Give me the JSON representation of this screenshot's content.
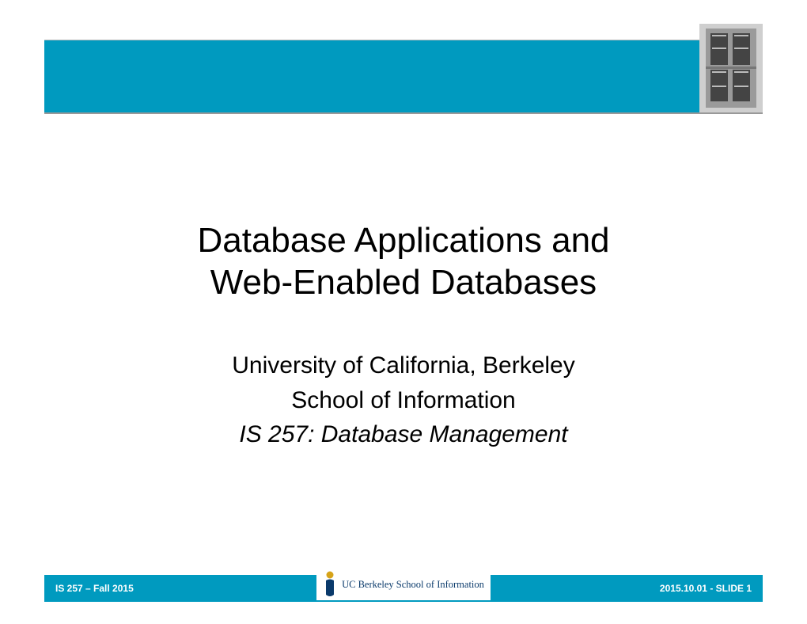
{
  "header": {
    "photo_alt": "building-facade"
  },
  "title": {
    "line1": "Database Applications and",
    "line2": "Web-Enabled Databases"
  },
  "subtitle": {
    "line1": "University of California, Berkeley",
    "line2": "School of Information",
    "line3": "IS 257: Database Management"
  },
  "footer": {
    "left": "IS 257 – Fall 2015",
    "logo_text": "UC Berkeley School of Information",
    "right": "2015.10.01 - SLIDE 1"
  },
  "colors": {
    "brand_teal": "#009abf",
    "logo_navy": "#0a3a6b",
    "logo_gold": "#d6a319"
  }
}
